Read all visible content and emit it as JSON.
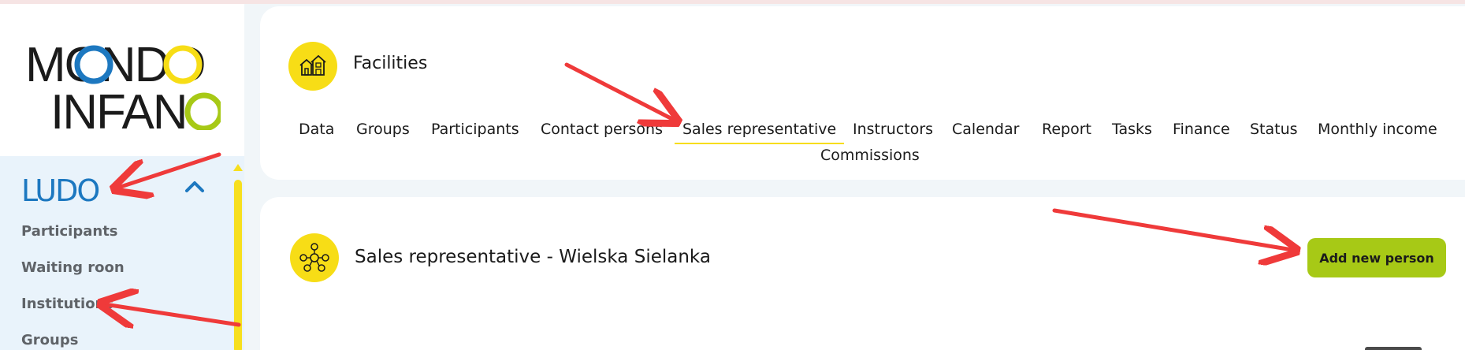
{
  "brand": {
    "logo_line1": "MONDO",
    "logo_line2": "INFANO"
  },
  "sidebar": {
    "section_title": "LUDO",
    "items": [
      {
        "label": "Participants"
      },
      {
        "label": "Waiting roon"
      },
      {
        "label": "Institutions"
      },
      {
        "label": "Groups"
      }
    ]
  },
  "header": {
    "title": "Facilities",
    "icon": "facilities-houses-icon"
  },
  "tabs": [
    {
      "label": "Data"
    },
    {
      "label": "Groups"
    },
    {
      "label": "Participants"
    },
    {
      "label": "Contact persons"
    },
    {
      "label": "Sales representative",
      "active": true
    },
    {
      "label": "Instructors"
    },
    {
      "label": "Calendar"
    },
    {
      "label": "Report"
    },
    {
      "label": "Tasks"
    },
    {
      "label": "Finance"
    },
    {
      "label": "Status"
    },
    {
      "label": "Monthly income"
    },
    {
      "label": "Commissions"
    }
  ],
  "section": {
    "title": "Sales representative - Wielska Sielanka",
    "icon": "people-network-icon",
    "add_button_label": "Add new person"
  },
  "colors": {
    "accent_yellow": "#f7dd16",
    "brand_blue": "#1d78c0",
    "button_green": "#a7c916",
    "arrow_red": "#ef3a3a"
  }
}
